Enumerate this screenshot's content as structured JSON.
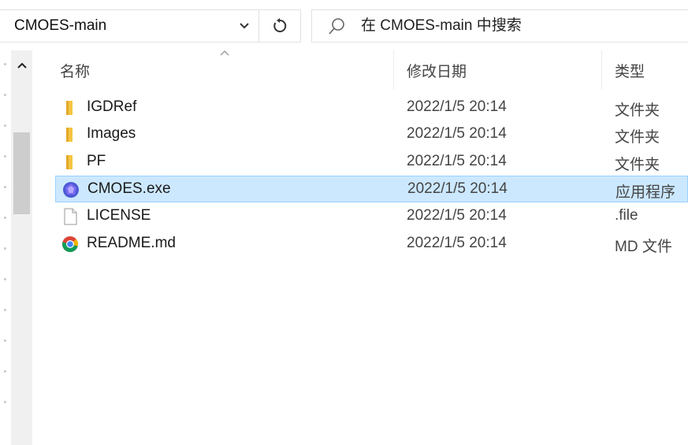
{
  "address_bar": {
    "current_path": "CMOES-main",
    "dropdown_icon": "chevron-down-icon",
    "refresh_icon": "refresh-icon"
  },
  "search": {
    "placeholder": "在 CMOES-main 中搜索",
    "icon": "search-icon"
  },
  "columns": {
    "name": "名称",
    "date_modified": "修改日期",
    "type": "类型",
    "sort_column": "名称",
    "sort_direction": "ascending"
  },
  "files": [
    {
      "name": "IGDRef",
      "date": "2022/1/5 20:14",
      "type": "文件夹",
      "icon": "folder-icon",
      "selected": false
    },
    {
      "name": "Images",
      "date": "2022/1/5 20:14",
      "type": "文件夹",
      "icon": "folder-icon",
      "selected": false
    },
    {
      "name": "PF",
      "date": "2022/1/5 20:14",
      "type": "文件夹",
      "icon": "folder-icon",
      "selected": false
    },
    {
      "name": "CMOES.exe",
      "date": "2022/1/5 20:14",
      "type": "应用程序",
      "icon": "app-icon",
      "selected": true
    },
    {
      "name": "LICENSE",
      "date": "2022/1/5 20:14",
      "type": ".file",
      "icon": "file-icon",
      "selected": false
    },
    {
      "name": "README.md",
      "date": "2022/1/5 20:14",
      "type": "MD 文件",
      "icon": "chrome-icon",
      "selected": false
    }
  ],
  "colors": {
    "selection_bg": "#cce8ff",
    "selection_border": "#99d1ff",
    "folder": "#f5c542"
  }
}
